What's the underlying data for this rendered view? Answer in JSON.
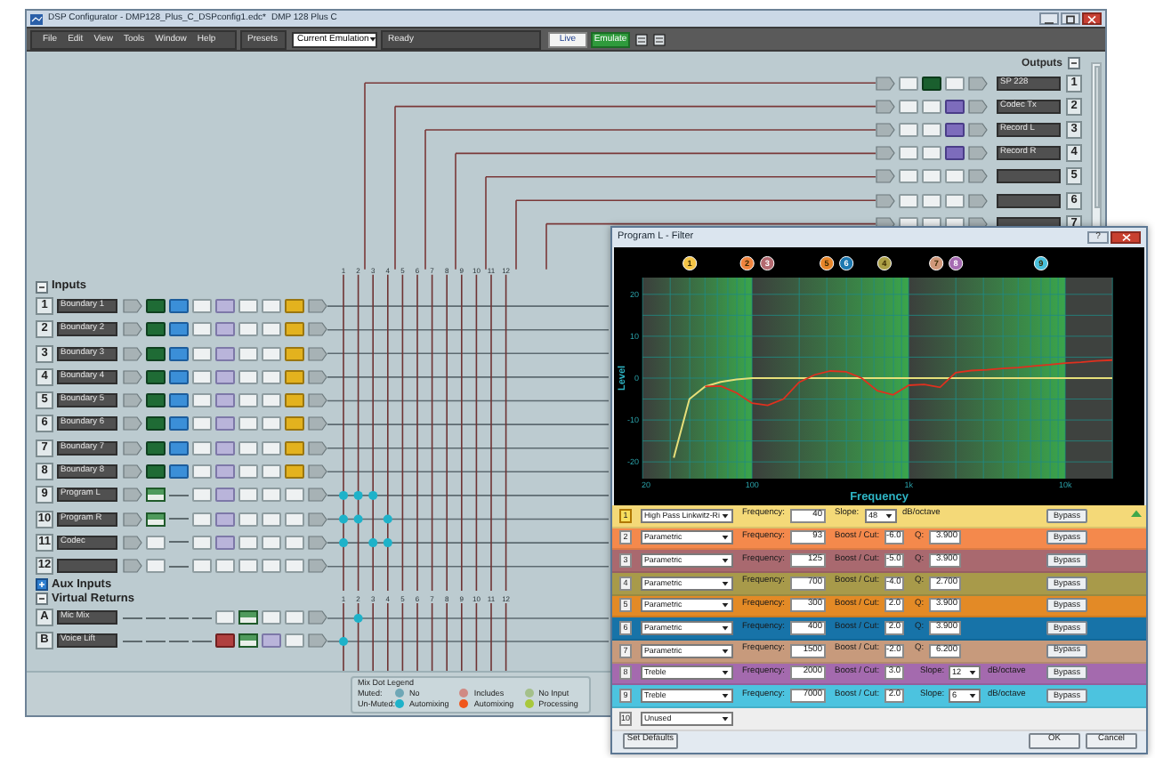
{
  "main_window": {
    "title": "DSP Configurator - DMP128_Plus_C_DSPconfig1.edc*",
    "device": "DMP 128 Plus C",
    "menu": [
      "File",
      "Edit",
      "View",
      "Tools",
      "Window",
      "Help"
    ],
    "presets_label": "Presets",
    "preset": "Current Emulation",
    "status": "Ready",
    "modes": [
      {
        "label": "Live",
        "selected": false
      },
      {
        "label": "Emulate",
        "selected": true
      }
    ],
    "outputs_title": "Outputs",
    "outputs_expanded": true,
    "outputs": [
      {
        "number": "1",
        "name": "SP 228",
        "kind": "filter"
      },
      {
        "number": "2",
        "name": "Codec Tx",
        "kind": "limiter"
      },
      {
        "number": "3",
        "name": "Record L",
        "kind": "limiter"
      },
      {
        "number": "4",
        "name": "Record R",
        "kind": "limiter"
      },
      {
        "number": "5",
        "kind": "plain"
      },
      {
        "number": "6",
        "kind": "plain"
      },
      {
        "number": "7",
        "kind": "plain"
      }
    ],
    "inputs_title": "Inputs",
    "inputs_expanded": true,
    "matrix_columns": [
      "1",
      "2",
      "3",
      "4",
      "5",
      "6",
      "7",
      "8",
      "9",
      "10",
      "11",
      "12"
    ],
    "inputs": [
      {
        "number": "1",
        "name": "Boundary 1",
        "kind": "mic"
      },
      {
        "number": "2",
        "name": "Boundary 2",
        "kind": "mic"
      },
      {
        "number": "3",
        "name": "Boundary 3",
        "kind": "mic"
      },
      {
        "number": "4",
        "name": "Boundary 4",
        "kind": "mic"
      },
      {
        "number": "5",
        "name": "Boundary 5",
        "kind": "mic"
      },
      {
        "number": "6",
        "name": "Boundary 6",
        "kind": "mic"
      },
      {
        "number": "7",
        "name": "Boundary 7",
        "kind": "mic"
      },
      {
        "number": "8",
        "name": "Boundary 8",
        "kind": "mic"
      },
      {
        "number": "9",
        "name": "Program L",
        "kind": "program",
        "mix": [
          true,
          true,
          true,
          false
        ]
      },
      {
        "number": "10",
        "name": "Program R",
        "kind": "program",
        "mix": [
          true,
          true,
          false,
          true
        ]
      },
      {
        "number": "11",
        "name": "Codec",
        "kind": "codec",
        "mix": [
          true,
          false,
          true,
          true
        ]
      },
      {
        "number": "12",
        "kind": "plain"
      }
    ],
    "aux_inputs": {
      "title": "Aux Inputs",
      "expanded": false
    },
    "virtual_returns": {
      "title": "Virtual Returns",
      "expanded": true,
      "columns": [
        "1",
        "2",
        "3",
        "4",
        "5",
        "6",
        "7",
        "8",
        "9",
        "10",
        "11",
        "12"
      ],
      "rows": [
        {
          "letter": "A",
          "name": "Mic Mix",
          "kind": "mix",
          "mix": [
            false,
            true
          ]
        },
        {
          "letter": "B",
          "name": "Voice Lift",
          "kind": "voice",
          "mix": [
            true
          ]
        }
      ]
    },
    "legend": {
      "title": "Mix Dot Legend",
      "row_labels": [
        "Muted:",
        "Un-Muted:"
      ],
      "items": [
        {
          "lines": [
            "No",
            "Automixing"
          ],
          "dots": [
            {
              "color": "#6fa7b6"
            },
            {
              "color": "#1eb2c9"
            }
          ]
        },
        {
          "lines": [
            "Includes",
            "Automixing"
          ],
          "dots": [
            {
              "color": "#d08a84"
            },
            {
              "color": "#f0561c"
            }
          ]
        },
        {
          "lines": [
            "No Input",
            "Processing"
          ],
          "dots": [
            {
              "color": "#a4c08a"
            },
            {
              "color": "#a8c83c"
            }
          ]
        }
      ]
    }
  },
  "filter_window": {
    "title": "Program L - Filter",
    "help": "?",
    "chart_data": {
      "type": "line",
      "xlabel": "Frequency",
      "ylabel": "Level",
      "categories": [
        "20",
        null,
        null,
        null,
        null,
        null,
        null,
        "100",
        null,
        null,
        null,
        null,
        null,
        null,
        null,
        null,
        null,
        "1k",
        null,
        null,
        null,
        null,
        null,
        null,
        null,
        null,
        null,
        "10k",
        null,
        null,
        null
      ],
      "series": [
        {
          "color": "#e6df7a",
          "values": [
            null,
            null,
            -19,
            -5,
            -2,
            -0.9,
            -0.3,
            0,
            0,
            0,
            0,
            0,
            0,
            0,
            0,
            0,
            0,
            0,
            0,
            0,
            0,
            0,
            0,
            0,
            0,
            0,
            0,
            0,
            0,
            0,
            0
          ]
        },
        {
          "color": "#e0301e",
          "values": [
            null,
            null,
            null,
            null,
            -2,
            -1.9,
            -3.5,
            -6,
            -6.5,
            -5,
            -1,
            0.8,
            1.7,
            1.5,
            0,
            -3,
            -4,
            -1.7,
            -1.5,
            -2.2,
            1.3,
            1.8,
            2,
            2.3,
            2.5,
            2.9,
            3.2,
            3.6,
            3.8,
            4.1,
            4.3
          ]
        }
      ],
      "ylim": [
        -24,
        24
      ],
      "grid": true,
      "yticks": [
        20,
        10,
        0,
        -10,
        -20
      ]
    },
    "band_markers": [
      {
        "label": "1",
        "color": "#f4c445"
      },
      {
        "label": "2",
        "color": "#f0843e"
      },
      {
        "label": "3",
        "color": "#b46a70"
      },
      {
        "label": "5",
        "color": "#e8862a"
      },
      {
        "label": "6",
        "color": "#1d78b0"
      },
      {
        "label": "4",
        "color": "#ada046"
      },
      {
        "label": "7",
        "color": "#d0987a"
      },
      {
        "label": "8",
        "color": "#a66bb2"
      },
      {
        "label": "9",
        "color": "#49c0dc"
      }
    ],
    "bands": [
      {
        "number": "1",
        "selected": true,
        "kind": "highpass",
        "color": "#f4d978",
        "type": "High Pass Linkwitz-Ri",
        "frequency_label": "Frequency:",
        "frequency": "40",
        "slope_label": "Slope:",
        "slope": "48",
        "slope_unit": "dB/octave",
        "bypass": "Bypass"
      },
      {
        "number": "2",
        "selected": false,
        "kind": "parametric",
        "color": "#f4894c",
        "type": "Parametric",
        "frequency_label": "Frequency:",
        "frequency": "93",
        "gain_label": "Boost / Cut:",
        "gain": "-6.0",
        "q_label": "Q:",
        "q": "3.900",
        "bypass": "Bypass"
      },
      {
        "number": "3",
        "selected": false,
        "kind": "parametric",
        "color": "#a9696f",
        "type": "Parametric",
        "frequency_label": "Frequency:",
        "frequency": "125",
        "gain_label": "Boost / Cut:",
        "gain": "-5.0",
        "q_label": "Q:",
        "q": "3.900",
        "bypass": "Bypass"
      },
      {
        "number": "4",
        "selected": false,
        "kind": "parametric",
        "color": "#a89a4a",
        "type": "Parametric",
        "frequency_label": "Frequency:",
        "frequency": "700",
        "gain_label": "Boost / Cut:",
        "gain": "-4.0",
        "q_label": "Q:",
        "q": "2.700",
        "bypass": "Bypass"
      },
      {
        "number": "5",
        "selected": false,
        "kind": "parametric",
        "color": "#e38a26",
        "type": "Parametric",
        "frequency_label": "Frequency:",
        "frequency": "300",
        "gain_label": "Boost / Cut:",
        "gain": "2.0",
        "q_label": "Q:",
        "q": "3.900",
        "bypass": "Bypass"
      },
      {
        "number": "6",
        "selected": false,
        "kind": "parametric",
        "color": "#1773a8",
        "type": "Parametric",
        "frequency_label": "Frequency:",
        "frequency": "400",
        "gain_label": "Boost / Cut:",
        "gain": "2.0",
        "q_label": "Q:",
        "q": "3.900",
        "bypass": "Bypass"
      },
      {
        "number": "7",
        "selected": false,
        "kind": "parametric",
        "color": "#c79a7c",
        "type": "Parametric",
        "frequency_label": "Frequency:",
        "frequency": "1500",
        "gain_label": "Boost / Cut:",
        "gain": "-2.0",
        "q_label": "Q:",
        "q": "6.200",
        "bypass": "Bypass"
      },
      {
        "number": "8",
        "selected": false,
        "kind": "shelf",
        "color": "#a46aae",
        "type": "Treble",
        "frequency_label": "Frequency:",
        "frequency": "2000",
        "gain_label": "Boost / Cut:",
        "gain": "3.0",
        "slope_label": "Slope:",
        "slope": "12",
        "slope_unit": "dB/octave",
        "bypass": "Bypass"
      },
      {
        "number": "9",
        "selected": false,
        "kind": "shelf",
        "color": "#4cc3df",
        "type": "Treble",
        "frequency_label": "Frequency:",
        "frequency": "7000",
        "gain_label": "Boost / Cut:",
        "gain": "2.0",
        "slope_label": "Slope:",
        "slope": "6",
        "slope_unit": "dB/octave",
        "bypass": "Bypass"
      },
      {
        "number": "10",
        "selected": false,
        "kind": "unused",
        "color": "#eeeeee",
        "type": "Unused"
      }
    ],
    "buttons": {
      "defaults": "Set Defaults",
      "ok": "OK",
      "cancel": "Cancel"
    }
  }
}
